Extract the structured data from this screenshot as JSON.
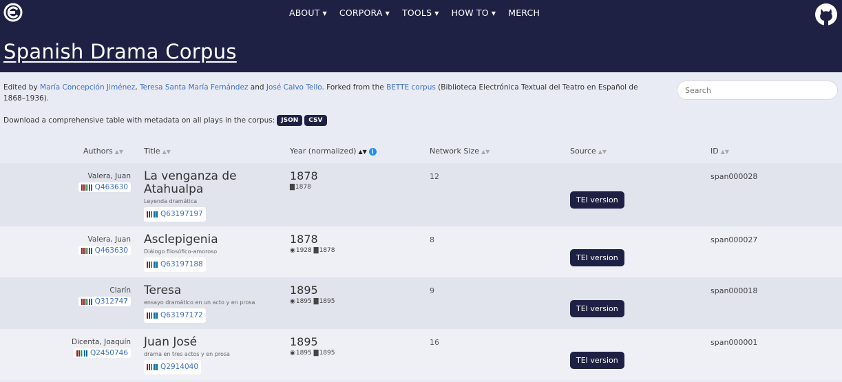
{
  "nav": {
    "items": [
      {
        "label": "ABOUT",
        "caret": true
      },
      {
        "label": "CORPORA",
        "caret": true
      },
      {
        "label": "TOOLS",
        "caret": true
      },
      {
        "label": "HOW TO",
        "caret": true
      },
      {
        "label": "MERCH",
        "caret": false
      }
    ],
    "caret_glyph": "▼"
  },
  "corpus_title": "Spanish Drama Corpus",
  "intro": {
    "edited_prefix": "Edited by ",
    "editor1": "María Concepción Jiménez",
    "sep1": ", ",
    "editor2": "Teresa Santa María Fernández",
    "sep2": " and ",
    "editor3": "José Calvo Tello",
    "forked": ". Forked from the ",
    "bette": "BETTE corpus",
    "bette_desc": " (Biblioteca Electrónica Textual del Teatro en Español de 1868–1936).",
    "download_text": "Download a comprehensive table with metadata on all plays in the corpus:",
    "json_label": "JSON",
    "csv_label": "CSV"
  },
  "search": {
    "placeholder": "Search"
  },
  "table": {
    "headers": {
      "authors": "Authors",
      "title": "Title",
      "year": "Year (normalized)",
      "network": "Network Size",
      "source": "Source",
      "id": "ID",
      "sort_glyphs": "▲▼",
      "info_glyph": "i"
    },
    "tei_label": "TEI version",
    "rows": [
      {
        "author": "Valera, Juan",
        "author_wd": "Q463630",
        "title": "La venganza de Atahualpa",
        "subtitle": "Leyenda dramática",
        "title_wd": "Q63197197",
        "year": "1878",
        "year_detail": "1878",
        "premiere": "",
        "network": "12",
        "id": "span000028"
      },
      {
        "author": "Valera, Juan",
        "author_wd": "Q463630",
        "title": "Asclepigenia",
        "subtitle": "Diálogo filosófico-amoroso",
        "title_wd": "Q63197188",
        "year": "1878",
        "premiere": "1928",
        "year_detail": "1878",
        "network": "8",
        "id": "span000027"
      },
      {
        "author": "Clarín",
        "author_wd": "Q312747",
        "title": "Teresa",
        "subtitle": "ensayo dramático en un acto y en prosa",
        "title_wd": "Q63197172",
        "year": "1895",
        "premiere": "1895",
        "year_detail": "1895",
        "network": "9",
        "id": "span000018"
      },
      {
        "author": "Dicenta, Joaquín",
        "author_wd": "Q2450746",
        "title": "Juan José",
        "subtitle": "drama en tres actos y en prosa",
        "title_wd": "Q2914040",
        "year": "1895",
        "premiere": "1895",
        "year_detail": "1895",
        "network": "16",
        "id": "span000001"
      }
    ]
  },
  "colors": {
    "header_bg": "#1f2144",
    "link": "#3d6fc7",
    "info": "#1f8fe8"
  }
}
